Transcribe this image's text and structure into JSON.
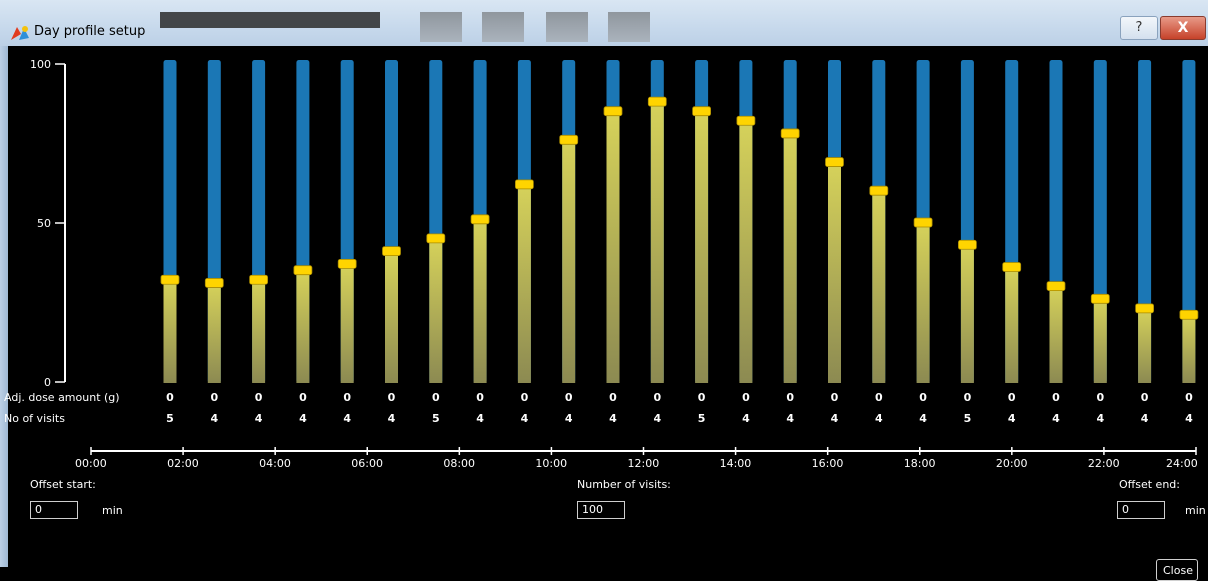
{
  "window": {
    "title": "Day profile setup",
    "help_label": "?",
    "close_label": "X"
  },
  "chart_data": {
    "type": "bar",
    "ylim": [
      0,
      100
    ],
    "y_ticks": [
      "100",
      "50",
      "0"
    ],
    "x_ticks": [
      "00:00",
      "02:00",
      "04:00",
      "06:00",
      "08:00",
      "10:00",
      "12:00",
      "14:00",
      "16:00",
      "18:00",
      "20:00",
      "22:00",
      "24:00"
    ],
    "values": [
      32,
      31,
      32,
      35,
      37,
      41,
      45,
      51,
      62,
      76,
      85,
      88,
      85,
      82,
      78,
      69,
      60,
      50,
      43,
      36,
      30,
      26,
      23,
      21
    ],
    "colors": {
      "track": "#1b77b5",
      "fill_top": "#d6d25a",
      "fill_bottom": "#8c8a52",
      "handle": "#ffd400"
    }
  },
  "rows": {
    "dose_label": "Adj. dose amount (g)",
    "dose_values": [
      "0",
      "0",
      "0",
      "0",
      "0",
      "0",
      "0",
      "0",
      "0",
      "0",
      "0",
      "0",
      "0",
      "0",
      "0",
      "0",
      "0",
      "0",
      "0",
      "0",
      "0",
      "0",
      "0",
      "0"
    ],
    "visits_label": "No of visits",
    "visits_values": [
      "5",
      "4",
      "4",
      "4",
      "4",
      "4",
      "5",
      "4",
      "4",
      "4",
      "4",
      "4",
      "5",
      "4",
      "4",
      "4",
      "4",
      "4",
      "5",
      "4",
      "4",
      "4",
      "4",
      "4"
    ]
  },
  "controls": {
    "offset_start_label": "Offset start:",
    "offset_start_value": "0",
    "offset_start_unit": "min",
    "visits_label": "Number of visits:",
    "visits_value": "100",
    "offset_end_label": "Offset end:",
    "offset_end_value": "0",
    "offset_end_unit": "min",
    "close_label": "Close"
  }
}
